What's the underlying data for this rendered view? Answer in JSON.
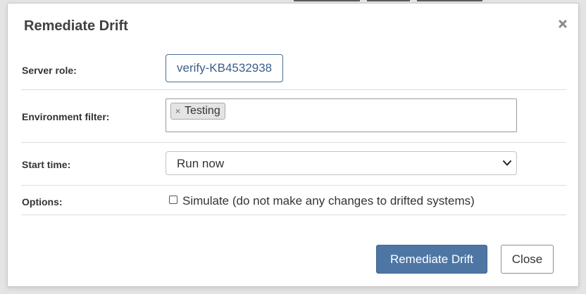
{
  "modal": {
    "title": "Remediate Drift",
    "close_glyph": "×"
  },
  "form": {
    "server_role": {
      "label": "Server role:",
      "value": "verify-KB4532938"
    },
    "environment_filter": {
      "label": "Environment filter:",
      "tags": [
        {
          "remove_glyph": "×",
          "label": "Testing"
        }
      ]
    },
    "start_time": {
      "label": "Start time:",
      "selected": "Run now"
    },
    "options": {
      "label": "Options:",
      "simulate": {
        "checked": false,
        "label": "Simulate (do not make any changes to drifted systems)"
      }
    }
  },
  "footer": {
    "primary_label": "Remediate Drift",
    "secondary_label": "Close"
  },
  "icons": {
    "close": "close-icon",
    "chevron": "chevron-down-icon",
    "tag_remove": "tag-remove-icon"
  },
  "colors": {
    "primary_button": "#4e76a5",
    "link_blue": "#3a5f8d",
    "title_text": "#404040"
  }
}
